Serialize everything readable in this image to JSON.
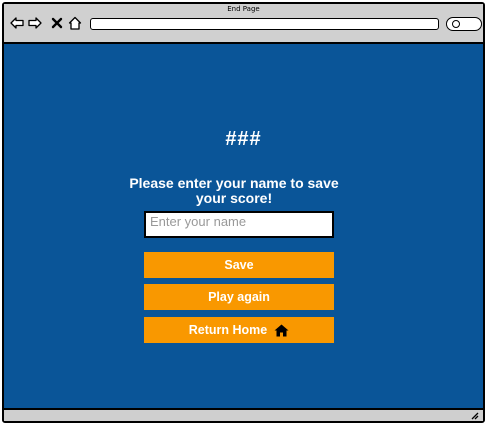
{
  "browser": {
    "page_title": "End Page",
    "icons": [
      "back-arrow-icon",
      "forward-arrow-icon",
      "close-icon",
      "home-icon",
      "search-icon"
    ],
    "url": ""
  },
  "main": {
    "score": "###",
    "prompt": "Please enter your name to save your score!",
    "name_input": {
      "value": "",
      "placeholder": "Enter your name"
    },
    "save_label": "Save",
    "play_again_label": "Play again",
    "return_home_label": "Return Home",
    "return_home_icon": "home-icon"
  },
  "colors": {
    "background": "#0a5598",
    "button": "#f99800",
    "text": "#ffffff"
  }
}
